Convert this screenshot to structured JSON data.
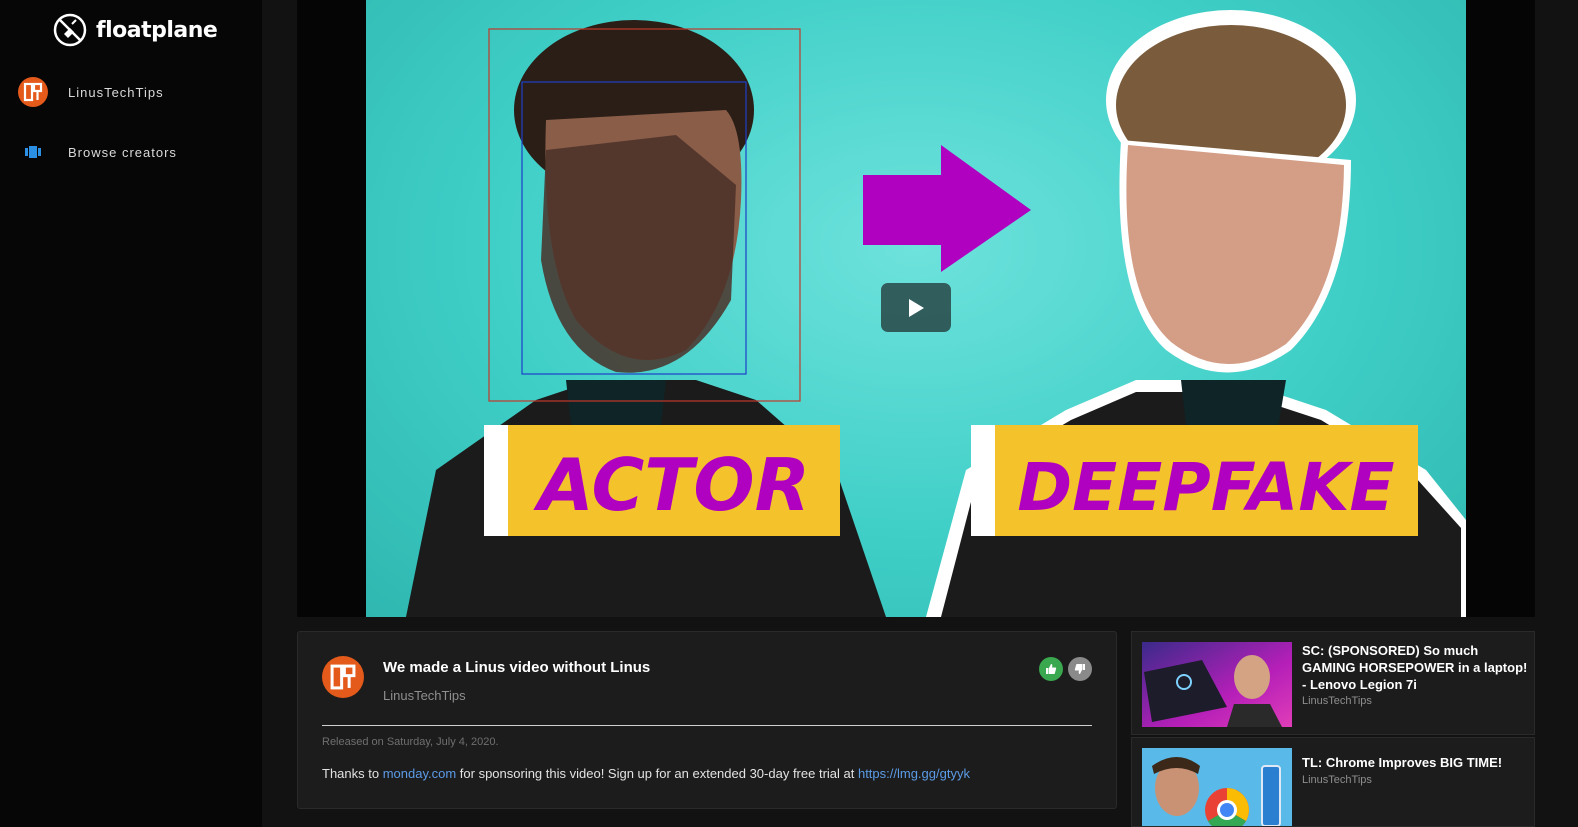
{
  "brand": {
    "name": "floatplane"
  },
  "sidebar": {
    "items": [
      {
        "label": "LinusTechTips"
      },
      {
        "label": "Browse creators"
      }
    ]
  },
  "player": {
    "thumbnail_text": {
      "left": "ACTOR",
      "right": "DEEPFAKE"
    }
  },
  "video": {
    "title": "We made a Linus video without Linus",
    "channel": "LinusTechTips",
    "released": "Released on Saturday, July 4, 2020.",
    "description": {
      "prefix": "Thanks to ",
      "link1": "monday.com",
      "middle": " for sponsoring this video! Sign up for an extended 30-day free trial at ",
      "link2": "https://lmg.gg/gtyyk"
    }
  },
  "related": [
    {
      "title": "SC: (SPONSORED) So much GAMING HORSEPOWER in a laptop! - Lenovo Legion 7i",
      "channel": "LinusTechTips"
    },
    {
      "title": "TL: Chrome Improves BIG TIME!",
      "channel": "LinusTechTips"
    }
  ],
  "colors": {
    "accent_orange": "#e35a1b",
    "like_green": "#3aa84f",
    "link_blue": "#5c9be6",
    "thumb_cyan": "#3fcfc7",
    "magenta": "#b000c0",
    "label_yellow": "#f4c22b"
  },
  "icons": {
    "brand": "floatplane-logo-icon",
    "creator": "ltt-logo-icon",
    "browse": "browse-creators-icon",
    "play": "play-icon",
    "like": "thumbs-up-icon",
    "dislike": "thumbs-down-icon"
  }
}
